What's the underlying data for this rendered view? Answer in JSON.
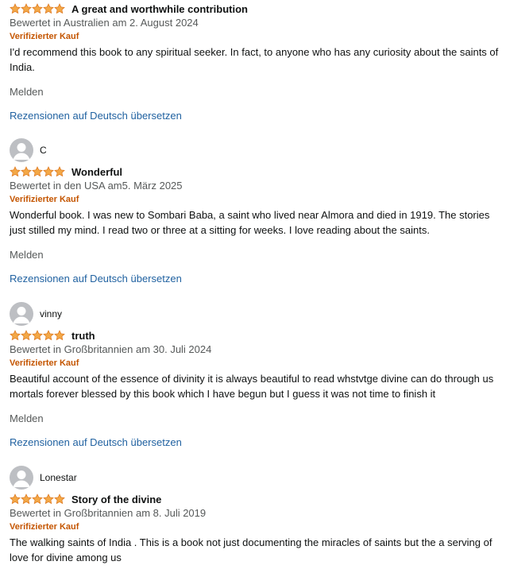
{
  "reviews": [
    {
      "profile_name": "",
      "rating": 5,
      "title": "A great and worthwhile contribution",
      "date": "Bewertet in Australien am 2. August 2024",
      "verified": "Verifizierter Kauf",
      "body": "I'd recommend this book to any spiritual seeker. In fact, to anyone who has any curiosity about the saints of India.",
      "report": "Melden",
      "translate": "Rezensionen auf Deutsch übersetzen"
    },
    {
      "profile_name": "C",
      "rating": 5,
      "title": "Wonderful",
      "date": "Bewertet in den USA am5. März 2025",
      "verified": "Verifizierter Kauf",
      "body": "Wonderful book. I was new to Sombari Baba, a saint who lived near Almora and died in 1919. The stories just stilled my mind. I read two or three at a sitting for weeks. I love reading about the saints.",
      "report": "Melden",
      "translate": "Rezensionen auf Deutsch übersetzen"
    },
    {
      "profile_name": "vinny",
      "rating": 5,
      "title": "truth",
      "date": "Bewertet in Großbritannien am 30. Juli 2024",
      "verified": "Verifizierter Kauf",
      "body": "Beautiful account of the essence of divinity it is always beautiful to read whstvtge divine can do through us mortals forever blessed by this book which I have begun but I guess it was not time to finish it",
      "report": "Melden",
      "translate": "Rezensionen auf Deutsch übersetzen"
    },
    {
      "profile_name": "Lonestar",
      "rating": 5,
      "title": "Story of the divine",
      "date": "Bewertet in Großbritannien am 8. Juli 2019",
      "verified": "Verifizierter Kauf",
      "body": "The walking saints of India . This is a book not just documenting the miracles of saints but the a serving of love for divine among us"
    }
  ],
  "colors": {
    "star": "#f3a847",
    "star_stroke": "#de7921",
    "verified": "#c45500",
    "link": "#2162a1",
    "muted": "#565959",
    "text": "#0f1111",
    "avatar_bg": "#bdbfc3"
  },
  "icons": {
    "star": "star-icon",
    "avatar": "default-avatar-icon"
  }
}
